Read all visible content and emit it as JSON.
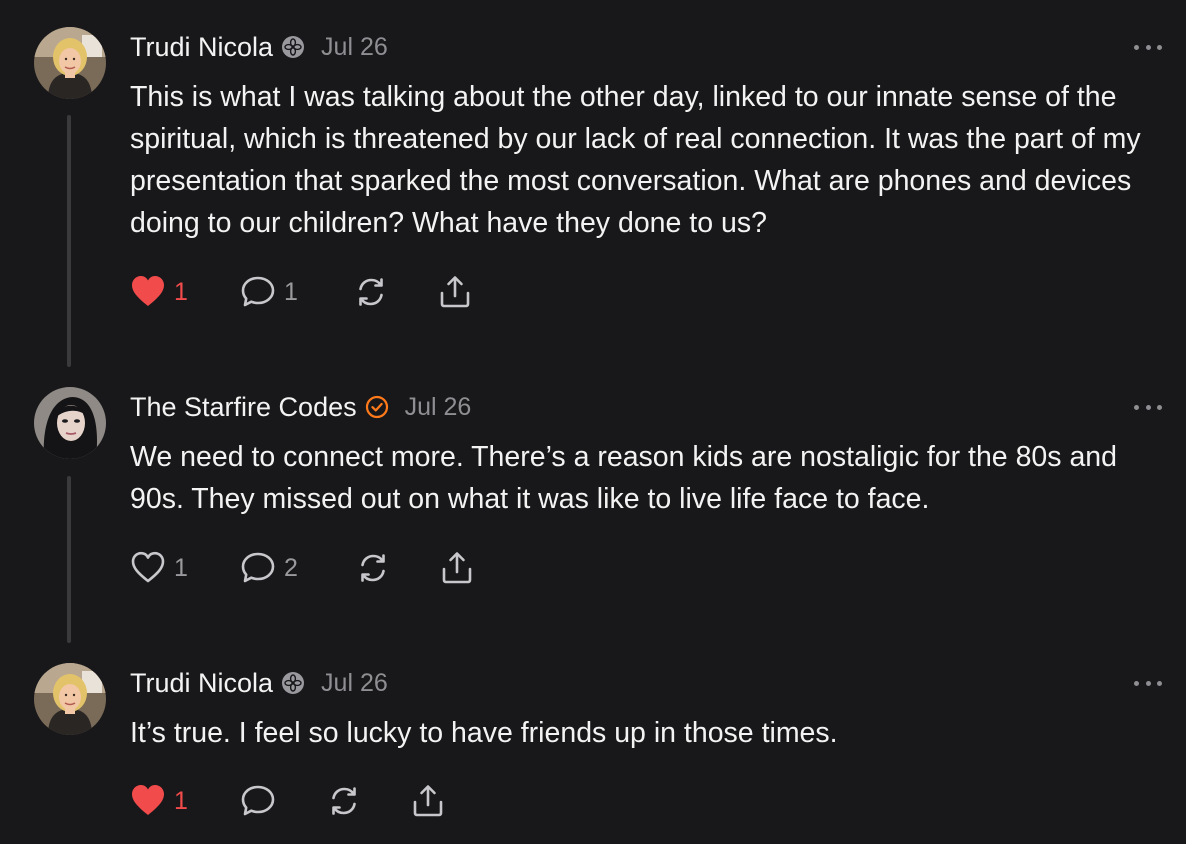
{
  "colors": {
    "background": "#18181a",
    "text": "#f3f3f3",
    "muted": "#8e8e93",
    "like_active": "#f24b4b",
    "verified_orange": "#ff7a1a",
    "thread_line": "#3a3a3c"
  },
  "posts": [
    {
      "author": "Trudi Nicola",
      "badge_icon": "flower-badge-icon",
      "date": "Jul 26",
      "text": "This is what I was talking about the other day, linked to our innate sense of the spiritual, which is threatened by our lack of real connection. It was the part of my presentation that sparked the most conversation. What are phones and devices doing to our children? What have they done to us?",
      "liked": true,
      "like_count": "1",
      "reply_count": "1"
    },
    {
      "author": "The Starfire Codes",
      "badge_icon": "verified-check-icon",
      "date": "Jul 26",
      "text": "We need to connect more. There’s a reason kids are nostaligic for the 80s and 90s. They missed out on what it was like to live life face to face.",
      "liked": false,
      "like_count": "1",
      "reply_count": "2"
    },
    {
      "author": "Trudi Nicola",
      "badge_icon": "flower-badge-icon",
      "date": "Jul 26",
      "text": "It’s true. I feel so lucky to have friends up in those times.",
      "liked": true,
      "like_count": "1",
      "reply_count": ""
    }
  ]
}
